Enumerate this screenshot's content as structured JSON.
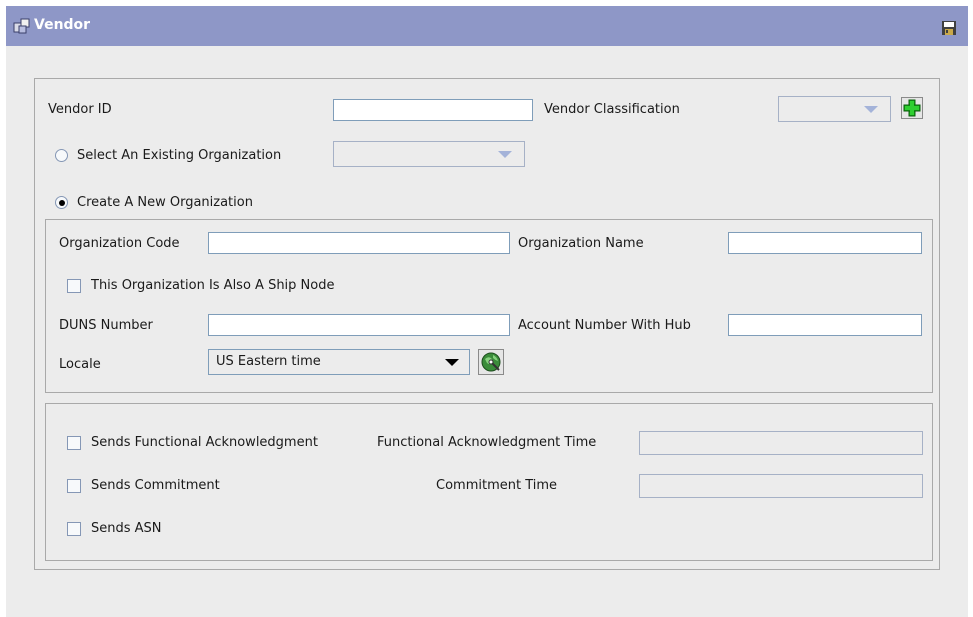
{
  "window": {
    "title": "Vendor"
  },
  "vendor": {
    "vendor_id_label": "Vendor ID",
    "vendor_id_value": "",
    "classification_label": "Vendor Classification",
    "classification_value": ""
  },
  "org_choice": {
    "existing_label": "Select An Existing Organization",
    "existing_value": "",
    "new_label": "Create A New Organization",
    "selected": "new"
  },
  "new_org": {
    "code_label": "Organization Code",
    "code_value": "",
    "name_label": "Organization Name",
    "name_value": "",
    "ship_node_label": "This Organization Is Also A Ship Node",
    "ship_node_checked": false,
    "duns_label": "DUNS Number",
    "duns_value": "",
    "account_label": "Account Number With Hub",
    "account_value": "",
    "locale_label": "Locale",
    "locale_value": "US Eastern time"
  },
  "edi": {
    "func_ack_label": "Sends Functional Acknowledgment",
    "func_ack_time_label": "Functional Acknowledgment Time",
    "func_ack_time_value": "",
    "commitment_label": "Sends Commitment",
    "commitment_time_label": "Commitment Time",
    "commitment_time_value": "",
    "asn_label": "Sends ASN"
  },
  "icons": {
    "app": "vendor-icon",
    "save": "save-icon",
    "add": "plus-icon",
    "locale_lookup": "globe-icon"
  },
  "colors": {
    "titlebar": "#8e97c7",
    "panel_bg": "#ececec",
    "field_border": "#7f9db9",
    "add_green": "#17a81a"
  }
}
